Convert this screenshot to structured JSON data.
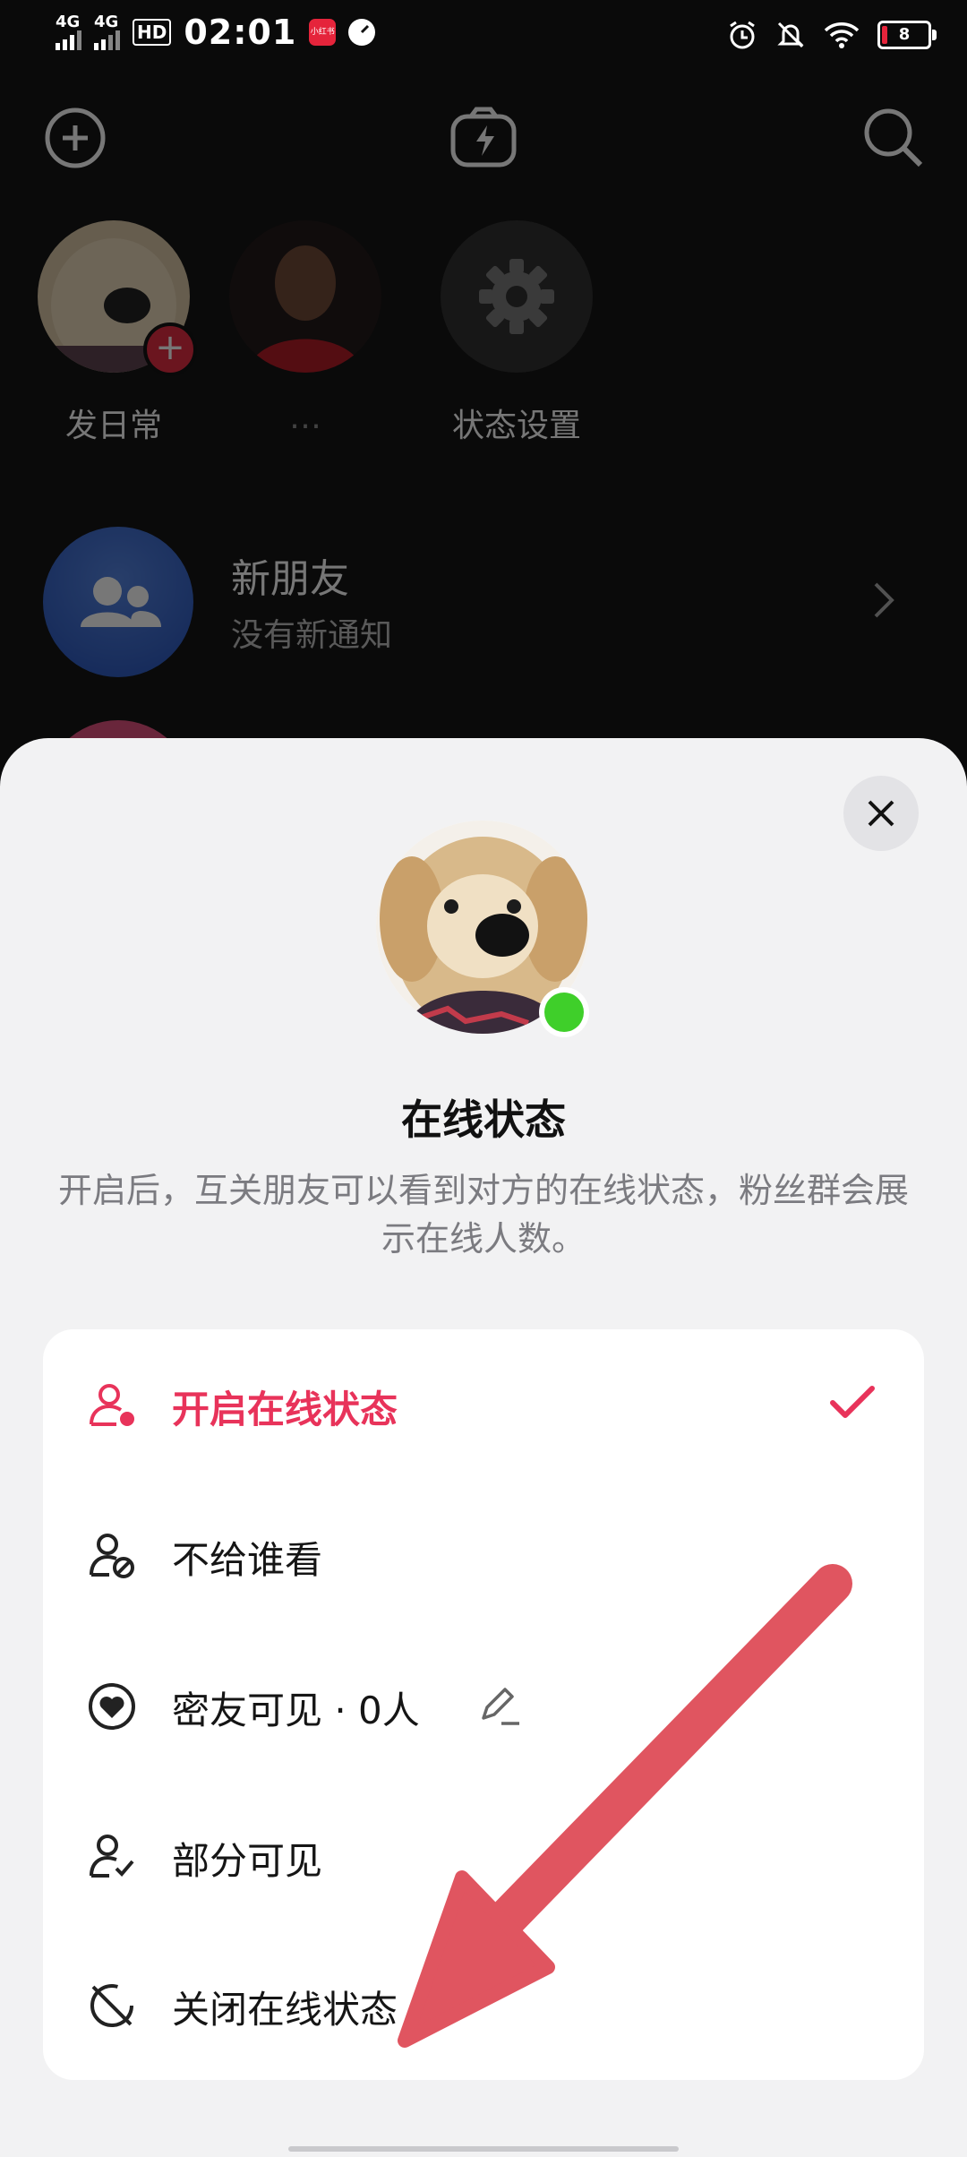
{
  "status_bar": {
    "net1": "4G",
    "net2": "4G",
    "hd": "HD",
    "time": "02:01",
    "app_badge": "小红书",
    "battery": "8"
  },
  "background": {
    "stories": [
      {
        "label": "发日常"
      },
      {
        "label": "…"
      },
      {
        "label": "状态设置"
      }
    ],
    "new_friends": {
      "title": "新朋友",
      "subtitle": "没有新通知"
    }
  },
  "sheet": {
    "title": "在线状态",
    "description": "开启后，互关朋友可以看到对方的在线状态，粉丝群会展示在线人数。",
    "options": [
      {
        "label": "开启在线状态",
        "selected": true,
        "icon": "user-online-icon"
      },
      {
        "label": "不给谁看",
        "selected": false,
        "icon": "user-block-icon"
      },
      {
        "label": "密友可见 · 0人",
        "selected": false,
        "icon": "heart-circle-icon"
      },
      {
        "label": "部分可见",
        "selected": false,
        "icon": "user-check-icon"
      },
      {
        "label": "关闭在线状态",
        "selected": false,
        "icon": "offline-icon"
      }
    ],
    "accent_color": "#e8335a",
    "online_color": "#3fcf2a"
  }
}
